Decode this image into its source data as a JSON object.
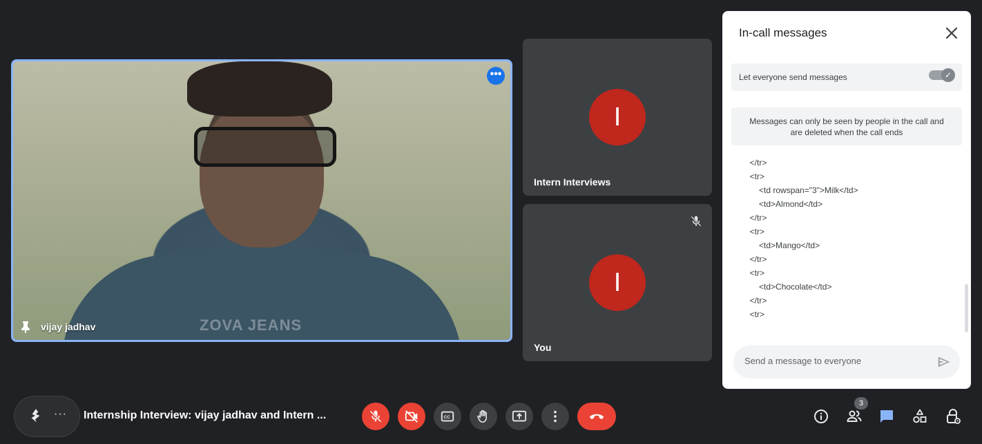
{
  "main_tile": {
    "participant_name": "vijay jadhav",
    "shirt_text": "ZOVA JEANS"
  },
  "tiles": [
    {
      "name": "Intern Interviews",
      "avatar_letter": "I",
      "muted": false
    },
    {
      "name": "You",
      "avatar_letter": "I",
      "muted": true
    }
  ],
  "chat": {
    "title": "In-call messages",
    "toggle_label": "Let everyone send messages",
    "toggle_on": true,
    "info_line1": "Messages can only be seen by people in the call and",
    "info_line2": "are deleted when the call ends",
    "message_lines": [
      "        </tr>",
      "        <tr>",
      "            <td rowspan=\"3\">Milk</td>",
      "            <td>Almond</td>",
      "        </tr>",
      "        <tr>",
      "            <td>Mango</td>",
      "        </tr>",
      "        <tr>",
      "            <td>Chocolate</td>",
      "        </tr>",
      "        <tr>"
    ],
    "send_placeholder": "Send a message to everyone"
  },
  "bottom_bar": {
    "meeting_title": "Internship Interview: vijay jadhav and Intern ...",
    "people_count": "3",
    "controls": [
      "mic-off",
      "camera-off",
      "captions",
      "raise-hand",
      "present",
      "more-options",
      "end-call"
    ],
    "right_icons": [
      "info",
      "people",
      "chat",
      "activities",
      "host-controls"
    ]
  },
  "colors": {
    "background": "#202124",
    "tile": "#3c4043",
    "accent": "#1a73e8",
    "active_border": "#8ab4f8",
    "danger": "#ea4335",
    "avatar": "#c0271d"
  }
}
